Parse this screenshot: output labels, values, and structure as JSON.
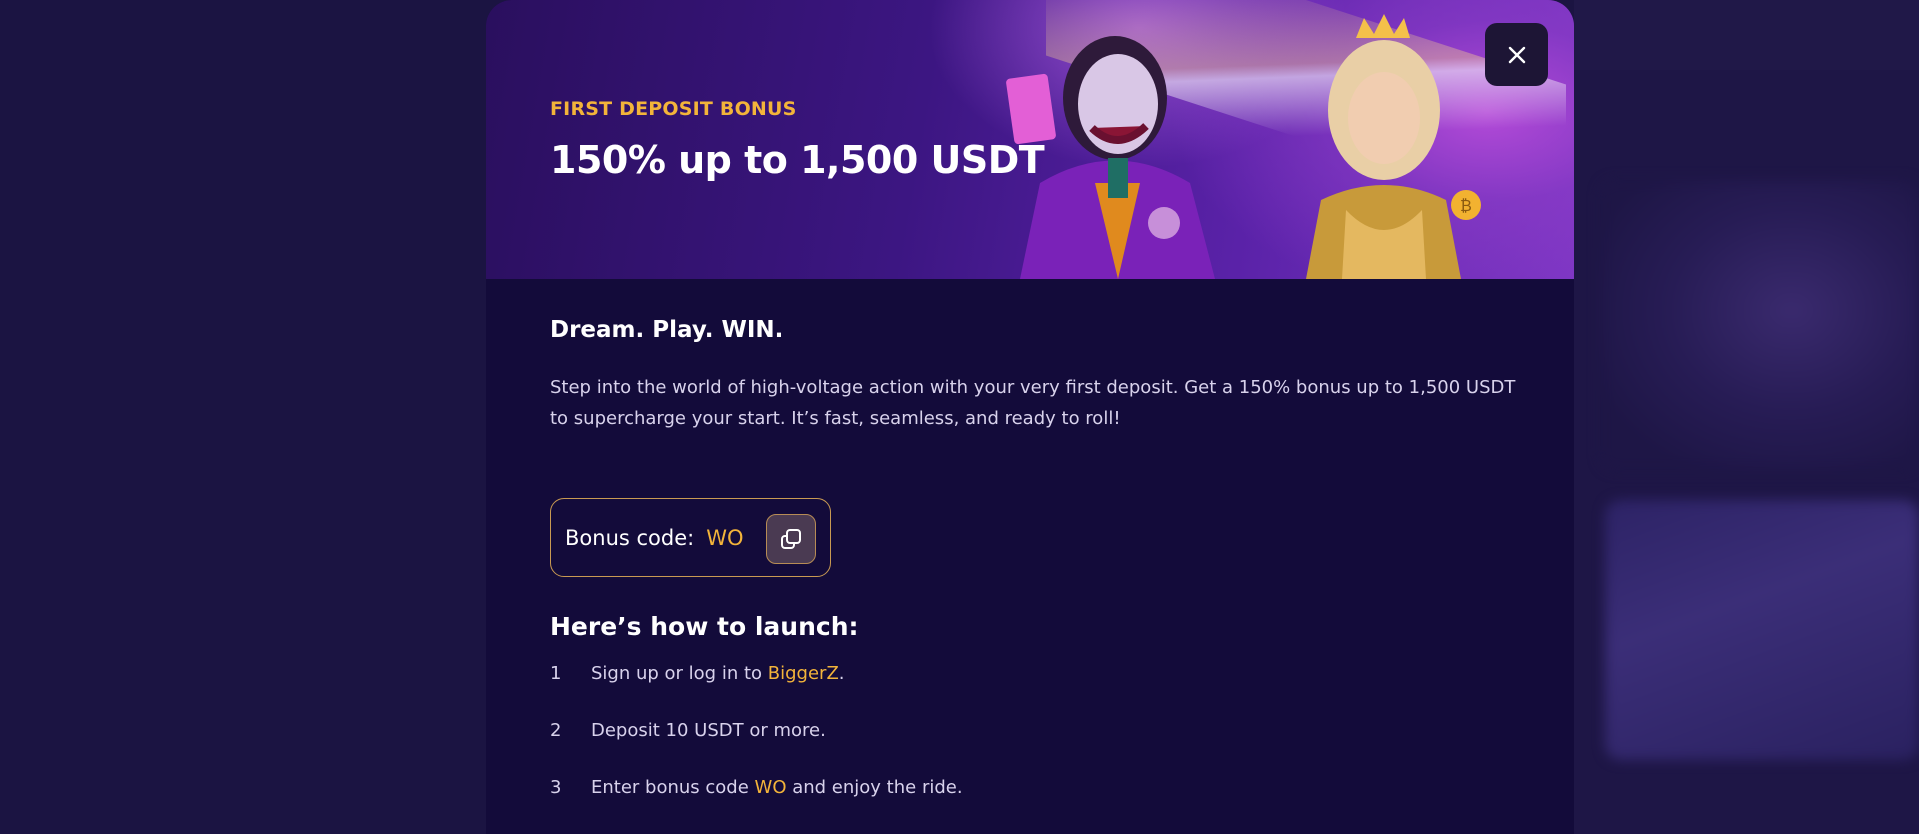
{
  "banner": {
    "kicker": "FIRST DEPOSIT BONUS",
    "title": "150% up to 1,500 USDT"
  },
  "close_icon": "close-icon",
  "content": {
    "tagline": "Dream. Play. WIN.",
    "description": "Step into the world of high-voltage action with your very first deposit. Get a 150% bonus up to 1,500 USDT to supercharge your start. It’s fast, seamless, and ready to roll!"
  },
  "bonus": {
    "label": "Bonus code:",
    "code": "WO",
    "copy_icon": "copy-icon"
  },
  "howto": {
    "title": "Here’s how to launch:",
    "steps": [
      {
        "num": "1",
        "before": "Sign up or log in to ",
        "accent": "BiggerZ",
        "after": "."
      },
      {
        "num": "2",
        "before": "Deposit 10 USDT or more.",
        "accent": "",
        "after": ""
      },
      {
        "num": "3",
        "before": "Enter bonus code ",
        "accent": "WO",
        "after": " and enjoy the ride."
      }
    ]
  },
  "colors": {
    "accent": "#f3b43a",
    "modal_bg": "#130b3a",
    "page_bg": "#1b1442"
  }
}
